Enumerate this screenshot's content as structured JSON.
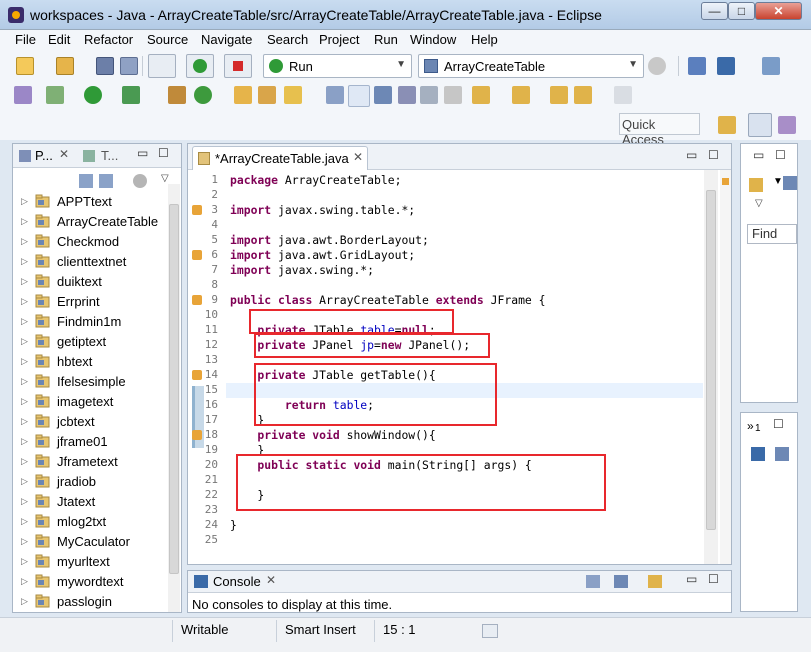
{
  "window": {
    "title": "workspaces - Java - ArrayCreateTable/src/ArrayCreateTable/ArrayCreateTable.java - Eclipse",
    "min_label": "—",
    "max_label": "□",
    "close_label": "✕"
  },
  "menu": [
    "File",
    "Edit",
    "Refactor",
    "Source",
    "Navigate",
    "Search",
    "Project",
    "Run",
    "Window",
    "Help"
  ],
  "toolbar": {
    "launch_mode": "Run",
    "launch_config": "ArrayCreateTable",
    "quick_access_placeholder": "Quick Access"
  },
  "package_explorer": {
    "tab_label": "P...",
    "tab2_label": "T...",
    "projects": [
      "APPTtext",
      "ArrayCreateTable",
      "Checkmod",
      "clienttextnet",
      "duiktext",
      "Errprint",
      "Findmin1m",
      "getiptext",
      "hbtext",
      "Ifelsesimple",
      "imagetext",
      "jcbtext",
      "jframe01",
      "Jframetext",
      "jradiob",
      "Jtatext",
      "mlog2txt",
      "MyCaculator",
      "myurltext",
      "mywordtext",
      "passlogin"
    ]
  },
  "editor": {
    "tab_label": "*ArrayCreateTable.java",
    "line_numbers": [
      "1",
      "2",
      "3",
      "4",
      "5",
      "6",
      "7",
      "8",
      "9",
      "10",
      "11",
      "12",
      "13",
      "14",
      "15",
      "16",
      "17",
      "18",
      "19",
      "20",
      "21",
      "22",
      "23",
      "24",
      "25"
    ],
    "code": [
      [
        {
          "t": "package",
          "c": "kw"
        },
        {
          "t": " ArrayCreateTable;",
          "c": ""
        }
      ],
      [],
      [
        {
          "t": "import",
          "c": "kw"
        },
        {
          "t": " javax.swing.table.*;",
          "c": ""
        }
      ],
      [],
      [
        {
          "t": "import",
          "c": "kw"
        },
        {
          "t": " java.awt.BorderLayout;",
          "c": ""
        }
      ],
      [
        {
          "t": "import",
          "c": "kw"
        },
        {
          "t": " java.awt.GridLayout;",
          "c": ""
        }
      ],
      [
        {
          "t": "import",
          "c": "kw"
        },
        {
          "t": " javax.swing.*;",
          "c": ""
        }
      ],
      [],
      [
        {
          "t": "public",
          "c": "kw"
        },
        {
          "t": " ",
          "c": ""
        },
        {
          "t": "class",
          "c": "kw"
        },
        {
          "t": " ArrayCreateTable ",
          "c": ""
        },
        {
          "t": "extends",
          "c": "kw"
        },
        {
          "t": " JFrame {",
          "c": ""
        }
      ],
      [],
      [
        {
          "t": "    private",
          "c": "kw"
        },
        {
          "t": " JTable ",
          "c": ""
        },
        {
          "t": "table",
          "c": "fld"
        },
        {
          "t": "=",
          "c": ""
        },
        {
          "t": "null",
          "c": "kw"
        },
        {
          "t": ";",
          "c": ""
        }
      ],
      [
        {
          "t": "    private",
          "c": "kw"
        },
        {
          "t": " JPanel ",
          "c": ""
        },
        {
          "t": "jp",
          "c": "fld"
        },
        {
          "t": "=",
          "c": ""
        },
        {
          "t": "new",
          "c": "kw"
        },
        {
          "t": " JPanel();",
          "c": ""
        }
      ],
      [],
      [
        {
          "t": "    private",
          "c": "kw"
        },
        {
          "t": " JTable getTable(){",
          "c": ""
        }
      ],
      [],
      [
        {
          "t": "        return",
          "c": "kw"
        },
        {
          "t": " ",
          "c": ""
        },
        {
          "t": "table",
          "c": "fld"
        },
        {
          "t": ";",
          "c": ""
        }
      ],
      [
        {
          "t": "    }",
          "c": ""
        }
      ],
      [
        {
          "t": "    private",
          "c": "kw"
        },
        {
          "t": " ",
          "c": ""
        },
        {
          "t": "void",
          "c": "kw"
        },
        {
          "t": " showWindow(){",
          "c": ""
        }
      ],
      [
        {
          "t": "    }",
          "c": ""
        }
      ],
      [
        {
          "t": "    public",
          "c": "kw"
        },
        {
          "t": " ",
          "c": ""
        },
        {
          "t": "static",
          "c": "kw"
        },
        {
          "t": " ",
          "c": ""
        },
        {
          "t": "void",
          "c": "kw"
        },
        {
          "t": " main(String[] args) {",
          "c": ""
        }
      ],
      [],
      [
        {
          "t": "    }",
          "c": ""
        }
      ],
      [],
      [
        {
          "t": "}",
          "c": ""
        }
      ],
      []
    ]
  },
  "right_panel": {
    "find_label": "Find",
    "tab_number": "1"
  },
  "console": {
    "tab_label": "Console",
    "message": "No consoles to display at this time."
  },
  "statusbar": {
    "mode": "Writable",
    "insert_mode": "Smart Insert",
    "position": "15 : 1"
  },
  "colors": {
    "annotation_box": "#e8282d",
    "keyword": "#7f0055",
    "field": "#0000c0"
  }
}
